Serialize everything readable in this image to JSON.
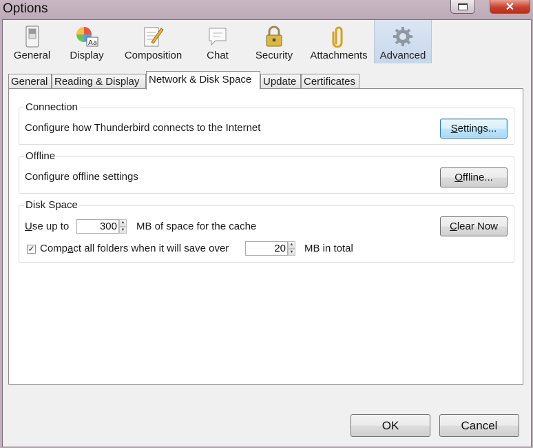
{
  "window": {
    "title": "Options"
  },
  "toolbar": {
    "items": [
      {
        "label": "General",
        "icon": "switch-icon"
      },
      {
        "label": "Display",
        "icon": "color-wheel-icon"
      },
      {
        "label": "Composition",
        "icon": "pencil-page-icon"
      },
      {
        "label": "Chat",
        "icon": "chat-bubble-icon"
      },
      {
        "label": "Security",
        "icon": "padlock-icon"
      },
      {
        "label": "Attachments",
        "icon": "paperclip-icon"
      },
      {
        "label": "Advanced",
        "icon": "gear-icon"
      }
    ],
    "active": "Advanced"
  },
  "tabs": {
    "items": [
      "General",
      "Reading & Display",
      "Network & Disk Space",
      "Update",
      "Certificates"
    ],
    "selected": "Network & Disk Space"
  },
  "connection": {
    "title": "Connection",
    "description": "Configure how Thunderbird connects to the Internet",
    "button": "Settings..."
  },
  "offline": {
    "title": "Offline",
    "description": "Configure offline settings",
    "button": "Offline..."
  },
  "disk_space": {
    "title": "Disk Space",
    "use_up_to_label": "Use up to",
    "cache_value": "300",
    "cache_suffix": "MB of space for the cache",
    "clear_button": "Clear Now",
    "compact_checked": true,
    "compact_label": "Compact all folders when it will save over",
    "compact_value": "20",
    "compact_suffix": "MB in total"
  },
  "dialog_buttons": {
    "ok": "OK",
    "cancel": "Cancel"
  },
  "colors": {
    "accent": "#3c7fb1",
    "active_tool_bg": "#c7d7ec",
    "close_button": "#c8412c"
  }
}
